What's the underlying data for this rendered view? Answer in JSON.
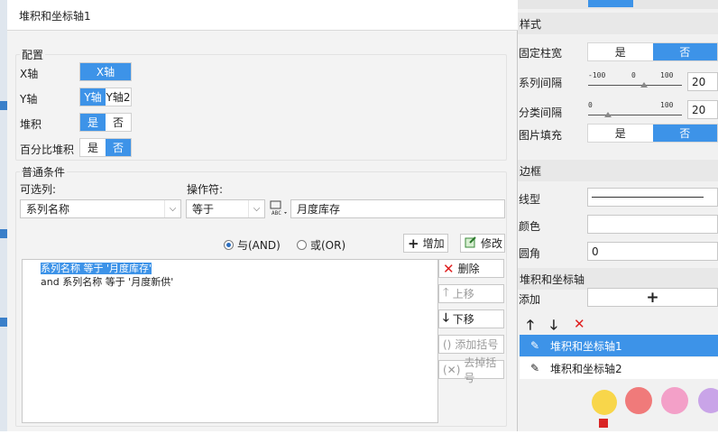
{
  "dialog": {
    "title": "堆积和坐标轴1",
    "config": {
      "title": "配置",
      "x_axis": {
        "label": "X轴",
        "options": [
          "X轴"
        ],
        "selected": "X轴"
      },
      "y_axis": {
        "label": "Y轴",
        "options": [
          "Y轴",
          "Y轴2"
        ],
        "selected": "Y轴"
      },
      "stack": {
        "label": "堆积",
        "options": [
          "是",
          "否"
        ],
        "selected": "是"
      },
      "percent_stack": {
        "label": "百分比堆积",
        "options": [
          "是",
          "否"
        ],
        "selected": "否"
      }
    },
    "condition": {
      "title": "普通条件",
      "available_label": "可选列:",
      "operator_label": "操作符:",
      "column_value": "系列名称",
      "operator_value": "等于",
      "value_text": "月度库存",
      "and_label": "与(AND)",
      "or_label": "或(OR)",
      "logic_selected": "and",
      "add_label": "增加",
      "modify_label": "修改",
      "rows": [
        "系列名称 等于 '月度库存'",
        "and 系列名称 等于 '月度新供'"
      ],
      "delete_label": "删除",
      "move_up_label": "上移",
      "move_down_label": "下移",
      "add_bracket_label": "添加括号",
      "remove_bracket_label": "去掉括号"
    }
  },
  "right": {
    "style_header": "样式",
    "fixed_width": {
      "label": "固定柱宽",
      "options": [
        "是",
        "否"
      ],
      "selected": "否"
    },
    "series_gap": {
      "label": "系列间隔",
      "min": "-100",
      "mid": "0",
      "max": "100",
      "value": "20",
      "numeric": 20
    },
    "category_gap": {
      "label": "分类间隔",
      "min": "0",
      "max": "100",
      "value": "20",
      "numeric": 20
    },
    "image_fill": {
      "label": "图片填充",
      "options": [
        "是",
        "否"
      ],
      "selected": "否"
    },
    "border_header": "边框",
    "line_type_label": "线型",
    "color_label": "颜色",
    "corner_label": "圆角",
    "corner_value": "0",
    "stack_header": "堆积和坐标轴",
    "add_label": "添加",
    "items": [
      "堆积和坐标轴1",
      "堆积和坐标轴2"
    ],
    "selected_item": 0
  },
  "colors": {
    "accent": "#3d93e8",
    "delete_red": "#e02020"
  }
}
